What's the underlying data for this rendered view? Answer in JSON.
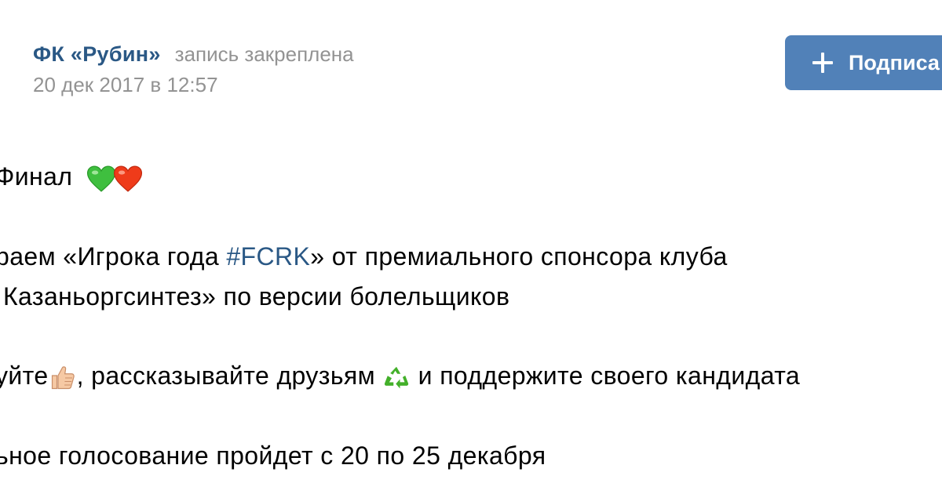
{
  "post": {
    "author": "ФК «Рубин»",
    "pinned": "запись закреплена",
    "date": "20 дек 2017 в 12:57"
  },
  "subscribe_button": {
    "label": "Подписа"
  },
  "content": {
    "line1": "Финал",
    "line2_pre": "раем «Игрока года ",
    "hashtag": "#FCRK",
    "line2_post": "» от премиального спонсора клуба",
    "line3": "Казаньоргсинтез» по версии болельщиков",
    "line4_pre": "уйте",
    "line4_mid": ", рассказывайте друзьям ",
    "line4_post": " и поддержите своего кандидата",
    "line5": "ьное голосование пройдет с 20 по 25 декабря"
  },
  "emojis": [
    "green-heart-icon",
    "red-heart-icon",
    "thumbs-up-icon",
    "recycle-icon"
  ],
  "colors": {
    "link": "#2a5885",
    "meta": "#939393",
    "button": "#5181b8",
    "green_heart": "#3fbf3f",
    "red_heart": "#ef3b1a",
    "recycle": "#43b02a",
    "thumb": "#f6c9a4"
  }
}
